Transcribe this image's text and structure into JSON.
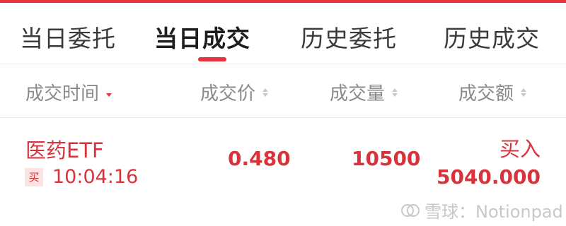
{
  "tabs": [
    "当日委托",
    "当日成交",
    "历史委托",
    "历史成交"
  ],
  "columns": {
    "time": "成交时间",
    "price": "成交价",
    "quantity": "成交量",
    "amount": "成交额"
  },
  "trade": {
    "name": "医药ETF",
    "badge": "买",
    "time": "10:04:16",
    "price": "0.480",
    "quantity": "10500",
    "side": "买入",
    "amount": "5040.000"
  },
  "watermark": {
    "text": "雪球：Notionpad"
  },
  "colors": {
    "accent": "#e8323c",
    "trade_red": "#d8323b",
    "header_gray": "#8a8a8a"
  },
  "icons": {
    "sort": "sort-arrows-icon",
    "watermark": "xueqiu-logo-icon"
  }
}
